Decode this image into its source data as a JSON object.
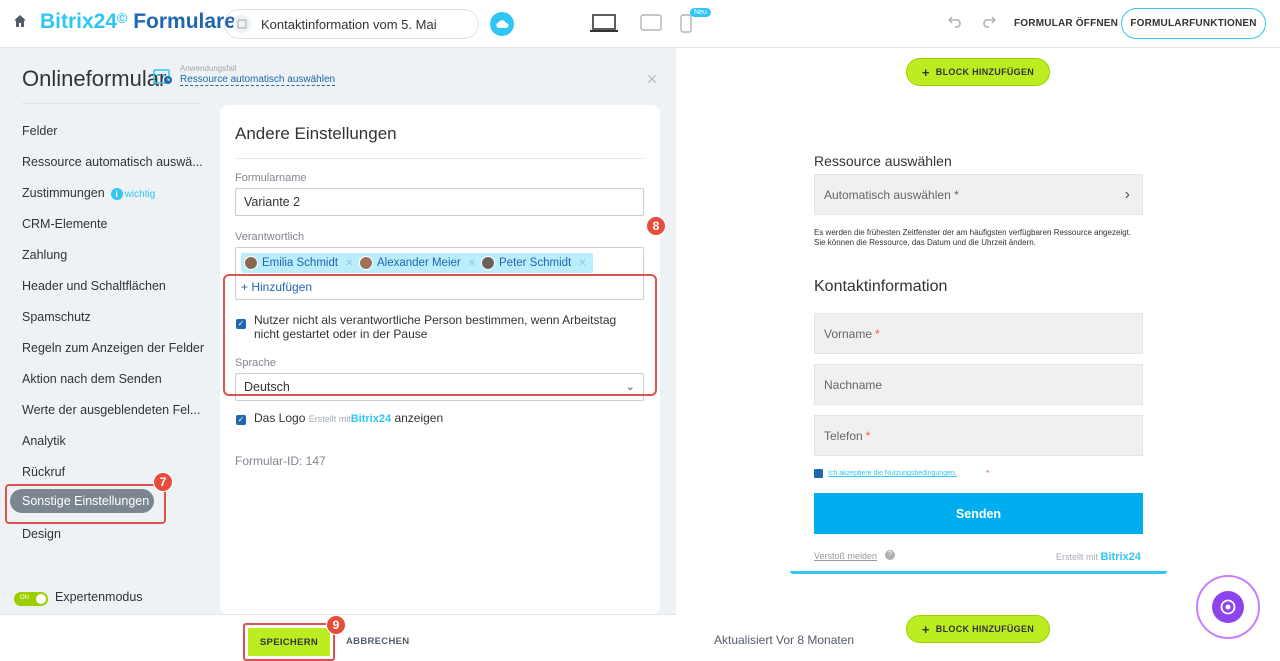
{
  "header": {
    "brand_main": "Bitrix24",
    "brand_mark": "©",
    "brand_suffix": " Formulare",
    "form_title": "Kontaktinformation vom 5. Mai",
    "new_badge": "Neu",
    "open_form": "FORMULAR ÖFFNEN",
    "form_functions": "FORMULARFUNKTIONEN"
  },
  "panel": {
    "title": "Onlineformular",
    "case_label": "Anwendungsfall",
    "case_value": "Ressource automatisch auswählen"
  },
  "sidebar": {
    "items": [
      {
        "label": "Felder"
      },
      {
        "label": "Ressource automatisch auswä..."
      },
      {
        "label": "Zustimmungen",
        "badge": "wichtig"
      },
      {
        "label": "CRM-Elemente"
      },
      {
        "label": "Zahlung"
      },
      {
        "label": "Header und Schaltflächen"
      },
      {
        "label": "Spamschutz"
      },
      {
        "label": "Regeln zum Anzeigen der Felder"
      },
      {
        "label": "Aktion nach dem Senden"
      },
      {
        "label": "Werte der ausgeblendeten Fel..."
      },
      {
        "label": "Analytik"
      },
      {
        "label": "Rückruf"
      },
      {
        "label": "Sonstige Einstellungen"
      },
      {
        "label": "Design"
      }
    ],
    "active_index": 12,
    "expert_mode_label": "Expertenmodus",
    "toggle_text": "ON"
  },
  "settings": {
    "title": "Andere Einstellungen",
    "form_name_label": "Formularname",
    "form_name_value": "Variante 2",
    "responsible_label": "Verantwortlich",
    "responsible": [
      {
        "name": "Emilia Schmidt"
      },
      {
        "name": "Alexander Meier"
      },
      {
        "name": "Peter Schmidt"
      }
    ],
    "add_label": "+ Hinzufügen",
    "workday_checkbox": "Nutzer nicht als verantwortliche Person bestimmen, wenn Arbeitstag nicht gestartet oder in der Pause",
    "language_label": "Sprache",
    "language_value": "Deutsch",
    "logo_prefix": "Das Logo",
    "logo_small": "Erstellt mit",
    "logo_brand": "Bitrix24",
    "logo_suffix": "anzeigen",
    "form_id": "Formular-ID: 147"
  },
  "footer": {
    "save": "SPEICHERN",
    "cancel": "ABBRECHEN",
    "updated": "Aktualisiert Vor 8 Monaten"
  },
  "preview": {
    "add_block": "BLOCK HINZUFÜGEN",
    "resource_heading": "Ressource auswählen",
    "resource_field": "Automatisch auswählen *",
    "resource_note": "Es werden die frühesten Zeitfenster der am häufigsten verfügbaren Ressource angezeigt. Sie können die Ressource, das Datum und die Uhrzeit ändern.",
    "contact_heading": "Kontaktinformation",
    "fields": [
      {
        "label": "Vorname",
        "required": "*"
      },
      {
        "label": "Nachname",
        "required": ""
      },
      {
        "label": "Telefon",
        "required": "*"
      }
    ],
    "terms": "Ich akzeptiere die Nutzungsbedingungen.",
    "terms_req": "*",
    "send": "Senden",
    "report": "Verstoß melden",
    "created_prefix": "Erstellt mit",
    "created_brand": "Bitrix24"
  },
  "annotations": {
    "step7": "7",
    "step8": "8",
    "step9": "9"
  },
  "colors": {
    "accent": "#2fc6f6",
    "brand_dark": "#2067b0",
    "save_green": "#bbed21",
    "highlight_red": "#d9534f"
  }
}
